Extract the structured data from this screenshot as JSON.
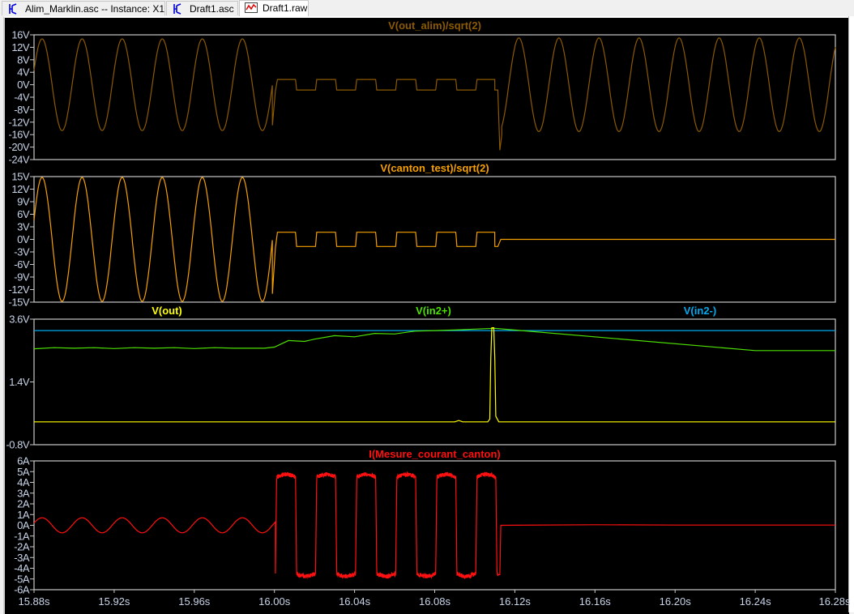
{
  "tabs": [
    {
      "label": "Alim_Marklin.asc -- Instance: X1",
      "icon": "schematic-icon",
      "active": false
    },
    {
      "label": "Draft1.asc",
      "icon": "schematic-icon",
      "active": false
    },
    {
      "label": "Draft1.raw",
      "icon": "waveform-icon",
      "active": true
    }
  ],
  "colors": {
    "background": "#000000",
    "axis": "#c8c8c8",
    "tick_text": "#c8d4e8"
  },
  "chart_data": [
    {
      "type": "line",
      "title": "",
      "xlim": [
        15.88,
        16.28
      ],
      "ylim": [
        -24,
        16
      ],
      "yticks": [
        "16V",
        "12V",
        "8V",
        "4V",
        "0V",
        "-4V",
        "-8V",
        "-12V",
        "-16V",
        "-20V",
        "-24V"
      ],
      "ytick_values": [
        16,
        12,
        8,
        4,
        0,
        -4,
        -8,
        -12,
        -16,
        -20,
        -24
      ],
      "series": [
        {
          "name": "V(out_alim)/sqrt(2)",
          "color": "#8c5a00",
          "segments": [
            {
              "type": "sine",
              "from": 15.88,
              "to": 15.999,
              "amp": 14.7,
              "freq": 50,
              "peak": 15.884
            },
            {
              "type": "points",
              "points": [
                [
                  15.999,
                  -13
                ],
                [
                  16.0005,
                  -2
                ],
                [
                  16.0015,
                  1.7
                ]
              ]
            },
            {
              "type": "square",
              "from": 16.0015,
              "to": 16.11,
              "high": 1.7,
              "low": -1.7,
              "freq": 50,
              "rise": 16.0005,
              "duty": 0.5
            },
            {
              "type": "points",
              "points": [
                [
                  16.11,
                  -1.7
                ],
                [
                  16.1115,
                  -1.7
                ],
                [
                  16.1125,
                  -21
                ],
                [
                  16.1135,
                  -16
                ]
              ]
            },
            {
              "type": "sine",
              "from": 16.1135,
              "to": 16.28,
              "amp": 15.0,
              "freq": 50,
              "peak": 16.122
            }
          ]
        }
      ]
    },
    {
      "type": "line",
      "title": "",
      "xlim": [
        15.88,
        16.28
      ],
      "ylim": [
        -15,
        15
      ],
      "yticks": [
        "15V",
        "12V",
        "9V",
        "6V",
        "3V",
        "0V",
        "-3V",
        "-6V",
        "-9V",
        "-12V",
        "-15V"
      ],
      "ytick_values": [
        15,
        12,
        9,
        6,
        3,
        0,
        -3,
        -6,
        -9,
        -12,
        -15
      ],
      "series": [
        {
          "name": "V(canton_test)/sqrt(2)",
          "color": "#f5a000",
          "segments": [
            {
              "type": "sine",
              "from": 15.88,
              "to": 15.999,
              "amp": 14.8,
              "freq": 50,
              "peak": 15.884
            },
            {
              "type": "points",
              "points": [
                [
                  15.999,
                  -13
                ],
                [
                  16.0005,
                  -2
                ],
                [
                  16.0015,
                  1.7
                ]
              ]
            },
            {
              "type": "square",
              "from": 16.0015,
              "to": 16.11,
              "high": 1.7,
              "low": -1.7,
              "freq": 50,
              "rise": 16.0005,
              "duty": 0.5
            },
            {
              "type": "points",
              "points": [
                [
                  16.11,
                  -1.7
                ],
                [
                  16.1115,
                  -1.7
                ],
                [
                  16.113,
                  0
                ],
                [
                  16.28,
                  0
                ]
              ]
            }
          ]
        }
      ]
    },
    {
      "type": "line",
      "title": "",
      "xlim": [
        15.88,
        16.28
      ],
      "ylim": [
        -0.8,
        3.6
      ],
      "yticks": [
        "3.6V",
        "1.4V",
        "-0.8V"
      ],
      "ytick_values": [
        3.6,
        1.4,
        -0.8
      ],
      "series": [
        {
          "name": "V(out)",
          "color": "#ffff00",
          "segments": [
            {
              "type": "points",
              "points": [
                [
                  15.88,
                  0
                ],
                [
                  16.09,
                  0
                ],
                [
                  16.092,
                  0.05
                ],
                [
                  16.094,
                  0
                ],
                [
                  16.1065,
                  0
                ],
                [
                  16.1075,
                  0.1
                ],
                [
                  16.108,
                  2.2
                ],
                [
                  16.1085,
                  3.3
                ],
                [
                  16.1095,
                  3.3
                ],
                [
                  16.11,
                  2.2
                ],
                [
                  16.1105,
                  0.2
                ],
                [
                  16.112,
                  0
                ],
                [
                  16.28,
                  0
                ]
              ]
            }
          ]
        },
        {
          "name": "V(in2+)",
          "color": "#4ce000",
          "segments": [
            {
              "type": "points",
              "points": [
                [
                  15.88,
                  2.56
                ],
                [
                  15.89,
                  2.6
                ],
                [
                  15.9,
                  2.58
                ],
                [
                  15.91,
                  2.6
                ],
                [
                  15.92,
                  2.57
                ],
                [
                  15.93,
                  2.6
                ],
                [
                  15.94,
                  2.58
                ],
                [
                  15.95,
                  2.6
                ],
                [
                  15.96,
                  2.57
                ],
                [
                  15.97,
                  2.6
                ],
                [
                  15.98,
                  2.58
                ],
                [
                  15.995,
                  2.58
                ],
                [
                  16.0,
                  2.62
                ],
                [
                  16.007,
                  2.85
                ],
                [
                  16.015,
                  2.82
                ],
                [
                  16.02,
                  2.9
                ],
                [
                  16.03,
                  3.02
                ],
                [
                  16.04,
                  2.98
                ],
                [
                  16.05,
                  3.1
                ],
                [
                  16.06,
                  3.08
                ],
                [
                  16.07,
                  3.18
                ],
                [
                  16.08,
                  3.2
                ],
                [
                  16.09,
                  3.22
                ],
                [
                  16.1,
                  3.25
                ],
                [
                  16.11,
                  3.28
                ],
                [
                  16.24,
                  2.5
                ],
                [
                  16.28,
                  2.5
                ]
              ]
            }
          ]
        },
        {
          "name": "V(in2-)",
          "color": "#00aaee",
          "segments": [
            {
              "type": "points",
              "points": [
                [
                  15.88,
                  3.2
                ],
                [
                  16.28,
                  3.2
                ]
              ]
            }
          ]
        }
      ]
    },
    {
      "type": "line",
      "title": "",
      "xlim": [
        15.88,
        16.28
      ],
      "ylim": [
        -6,
        6
      ],
      "yticks": [
        "6A",
        "5A",
        "4A",
        "3A",
        "2A",
        "1A",
        "0A",
        "-1A",
        "-2A",
        "-3A",
        "-4A",
        "-5A",
        "-6A"
      ],
      "ytick_values": [
        6,
        5,
        4,
        3,
        2,
        1,
        0,
        -1,
        -2,
        -3,
        -4,
        -5,
        -6
      ],
      "xticks": [
        "15.88s",
        "15.92s",
        "15.96s",
        "16.00s",
        "16.04s",
        "16.08s",
        "16.12s",
        "16.16s",
        "16.20s",
        "16.24s",
        "16.28s"
      ],
      "xtick_values": [
        15.88,
        15.92,
        15.96,
        16.0,
        16.04,
        16.08,
        16.12,
        16.16,
        16.2,
        16.24,
        16.28
      ],
      "series": [
        {
          "name": "I(Mesure_courant_canton)",
          "color": "#ff1010",
          "segments": [
            {
              "type": "sine",
              "from": 15.88,
              "to": 16.0005,
              "amp": 0.7,
              "freq": 50,
              "peak": 15.884
            },
            {
              "type": "square",
              "from": 16.0005,
              "to": 16.1115,
              "high": 4.5,
              "low": -4.5,
              "freq": 50,
              "rise": 16.0005,
              "duty": 0.5,
              "noise": 0.2
            },
            {
              "type": "points",
              "points": [
                [
                  16.1115,
                  -4.6
                ],
                [
                  16.1125,
                  -4.6
                ],
                [
                  16.113,
                  0
                ],
                [
                  16.16,
                  0.05
                ],
                [
                  16.2,
                  0.02
                ],
                [
                  16.28,
                  0.02
                ]
              ]
            }
          ]
        }
      ]
    }
  ]
}
